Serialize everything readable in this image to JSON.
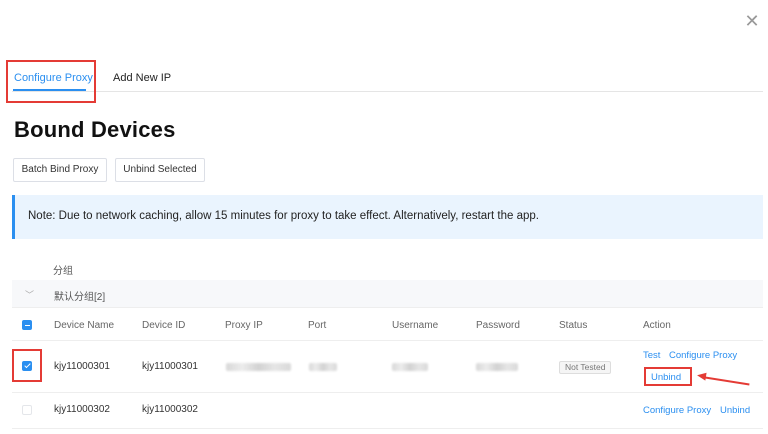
{
  "dialog": {
    "close_icon": "close-icon"
  },
  "tabs": [
    {
      "label": "Configure Proxy",
      "active": true
    },
    {
      "label": "Add New IP",
      "active": false
    }
  ],
  "page_title": "Bound Devices",
  "toolbar": {
    "batch_bind_label": "Batch Bind Proxy",
    "unbind_selected_label": "Unbind Selected"
  },
  "notice": {
    "text": "Note: Due to network caching, allow 15 minutes for proxy to take effect. Alternatively, restart the app."
  },
  "group": {
    "header": "分组",
    "name": "默认分组[2]",
    "chevron_icon": "chevron-down-icon"
  },
  "table": {
    "columns": [
      "Device Name",
      "Device ID",
      "Proxy IP",
      "Port",
      "Username",
      "Password",
      "Status",
      "Action"
    ],
    "rows": [
      {
        "device_name": "kjy11000301",
        "device_id": "kjy11000301",
        "checked": true,
        "status": "Not Tested",
        "actions": {
          "test": "Test",
          "configure": "Configure Proxy",
          "unbind": "Unbind"
        }
      },
      {
        "device_name": "kjy11000302",
        "device_id": "kjy11000302",
        "checked": false,
        "status": "",
        "actions": {
          "configure": "Configure Proxy",
          "unbind": "Unbind"
        }
      }
    ]
  },
  "colors": {
    "accent": "#2b8ff0",
    "annotation_red": "#e43b35",
    "notice_bg": "#eaf4fe"
  }
}
